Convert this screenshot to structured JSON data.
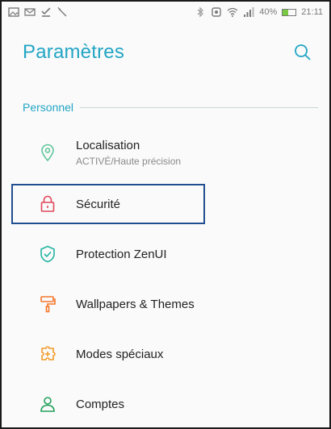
{
  "status_bar": {
    "battery_percent": "40%",
    "battery_level": 0.4,
    "time": "21:11",
    "left_icons": [
      "image-icon",
      "message-icon",
      "check-download-icon",
      "wand-icon"
    ],
    "right_icons": [
      "bluetooth-icon",
      "nfc-icon",
      "wifi-icon",
      "signal-icon"
    ]
  },
  "header": {
    "title": "Paramètres",
    "search_icon": "search-icon"
  },
  "section": {
    "label": "Personnel"
  },
  "items": [
    {
      "label": "Localisation",
      "sublabel": "ACTIVÉ/Haute précision",
      "icon": "location-pin-icon",
      "color": "#5fc59a"
    },
    {
      "label": "Sécurité",
      "icon": "lock-icon",
      "color": "#e0475a"
    },
    {
      "label": "Protection ZenUI",
      "icon": "shield-check-icon",
      "color": "#22b3a1"
    },
    {
      "label": "Wallpapers & Themes",
      "icon": "paint-roller-icon",
      "color": "#f4772c"
    },
    {
      "label": "Modes spéciaux",
      "icon": "puzzle-icon",
      "color": "#f29b2b"
    },
    {
      "label": "Comptes",
      "icon": "person-icon",
      "color": "#22a05a"
    }
  ],
  "colors": {
    "accent": "#22a5c4",
    "highlight_border": "#1f4f8f"
  }
}
